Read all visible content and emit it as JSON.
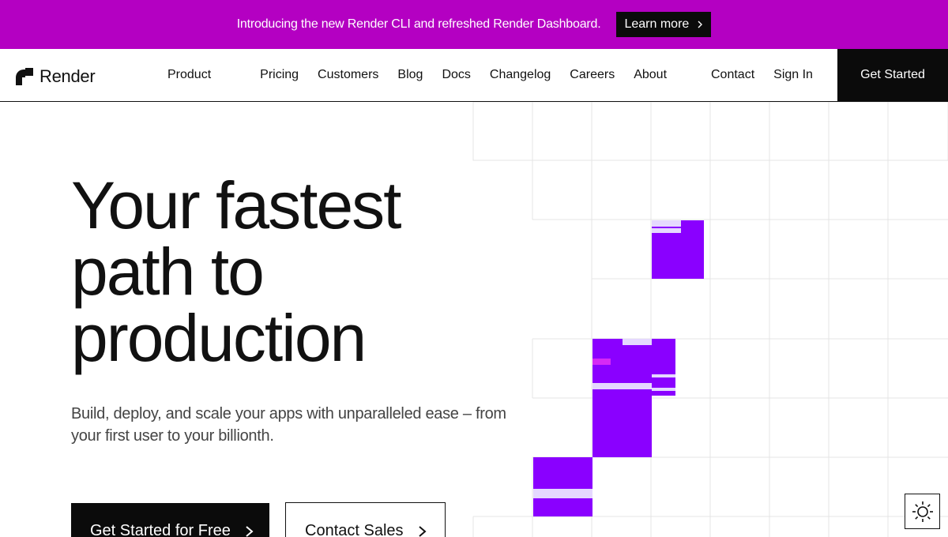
{
  "banner": {
    "text": "Introducing the new Render CLI and refreshed Render Dashboard.",
    "button_label": "Learn more",
    "background": "#b400c2"
  },
  "nav": {
    "logo_text": "Render",
    "links": [
      "Product",
      "Pricing",
      "Customers",
      "Blog",
      "Docs",
      "Changelog",
      "Careers",
      "About"
    ],
    "contact": "Contact",
    "sign_in": "Sign In",
    "get_started": "Get Started"
  },
  "hero": {
    "title_lines": [
      "Your fastest",
      "path to",
      "production"
    ],
    "subtitle": "Build, deploy, and scale your apps with unparalleled ease – from your first user to your billionth.",
    "cta_primary": "Get Started for Free",
    "cta_secondary": "Contact Sales"
  },
  "colors": {
    "accent_purple": "#8a00ff",
    "light_lavender": "#e5d8ff",
    "magenta": "#d629f5",
    "grid_line": "#e4e4e4"
  },
  "theme_toggle": {
    "icon": "sun-icon"
  }
}
